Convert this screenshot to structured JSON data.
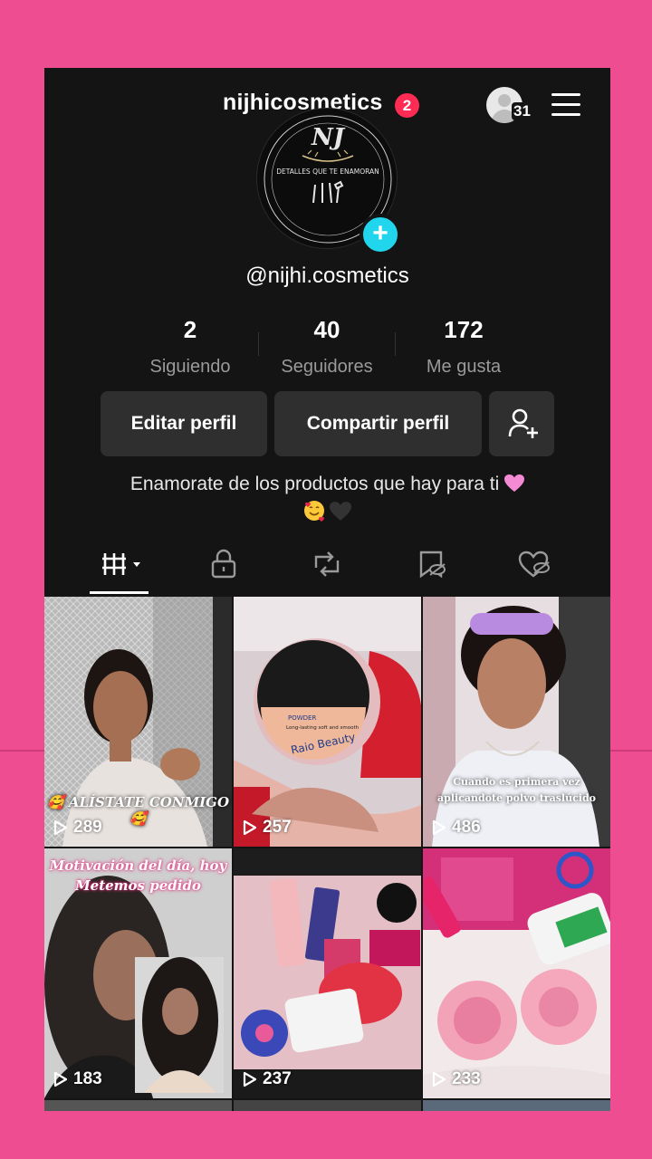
{
  "header": {
    "username": "nijhicosmetics",
    "notification_count": "2",
    "visitor_count": "31"
  },
  "profile": {
    "handle": "@nijhi.cosmetics",
    "avatar_logo_text": "NJ",
    "avatar_tagline": "DETALLES QUE TE ENAMORAN"
  },
  "stats": [
    {
      "value": "2",
      "label": "Siguiendo"
    },
    {
      "value": "40",
      "label": "Seguidores"
    },
    {
      "value": "172",
      "label": "Me gusta"
    }
  ],
  "buttons": {
    "edit": "Editar perfil",
    "share": "Compartir perfil"
  },
  "bio": {
    "line1": "Enamorate de los productos que hay para ti",
    "emojis_line1": "pink-heart",
    "emojis_line2": [
      "smiling-face-with-hearts",
      "black-heart"
    ]
  },
  "tabs": [
    "videos-grid-icon",
    "lock-icon",
    "repost-icon",
    "favorites-hidden-icon",
    "liked-hidden-icon"
  ],
  "videos": [
    {
      "views": "289",
      "caption": "🥰 ALÍSTATE CONMIGO 🥰"
    },
    {
      "views": "257",
      "caption": "",
      "product_text": [
        "POWDER",
        "Long-lasting soft and smooth",
        "Raio Beauty"
      ]
    },
    {
      "views": "486",
      "caption": "Cuando es primera vez aplicandote polvo traslúcido"
    },
    {
      "views": "183",
      "caption": "Motivación del día, hoy Metemos pedido"
    },
    {
      "views": "237",
      "caption": ""
    },
    {
      "views": "233",
      "caption": ""
    }
  ],
  "colors": {
    "background": "#ee4d92",
    "app_bg": "#141414",
    "badge": "#fe2c55",
    "add_button": "#20d5ec",
    "button_bg": "#2f2f2f"
  }
}
